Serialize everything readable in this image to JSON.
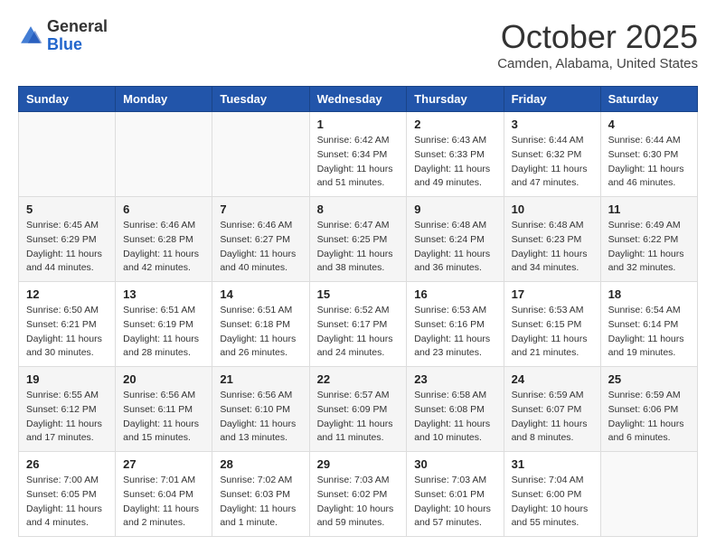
{
  "header": {
    "logo_general": "General",
    "logo_blue": "Blue",
    "month_title": "October 2025",
    "location": "Camden, Alabama, United States"
  },
  "days_of_week": [
    "Sunday",
    "Monday",
    "Tuesday",
    "Wednesday",
    "Thursday",
    "Friday",
    "Saturday"
  ],
  "weeks": [
    [
      {
        "day": "",
        "sunrise": "",
        "sunset": "",
        "daylight": ""
      },
      {
        "day": "",
        "sunrise": "",
        "sunset": "",
        "daylight": ""
      },
      {
        "day": "",
        "sunrise": "",
        "sunset": "",
        "daylight": ""
      },
      {
        "day": "1",
        "sunrise": "Sunrise: 6:42 AM",
        "sunset": "Sunset: 6:34 PM",
        "daylight": "Daylight: 11 hours and 51 minutes."
      },
      {
        "day": "2",
        "sunrise": "Sunrise: 6:43 AM",
        "sunset": "Sunset: 6:33 PM",
        "daylight": "Daylight: 11 hours and 49 minutes."
      },
      {
        "day": "3",
        "sunrise": "Sunrise: 6:44 AM",
        "sunset": "Sunset: 6:32 PM",
        "daylight": "Daylight: 11 hours and 47 minutes."
      },
      {
        "day": "4",
        "sunrise": "Sunrise: 6:44 AM",
        "sunset": "Sunset: 6:30 PM",
        "daylight": "Daylight: 11 hours and 46 minutes."
      }
    ],
    [
      {
        "day": "5",
        "sunrise": "Sunrise: 6:45 AM",
        "sunset": "Sunset: 6:29 PM",
        "daylight": "Daylight: 11 hours and 44 minutes."
      },
      {
        "day": "6",
        "sunrise": "Sunrise: 6:46 AM",
        "sunset": "Sunset: 6:28 PM",
        "daylight": "Daylight: 11 hours and 42 minutes."
      },
      {
        "day": "7",
        "sunrise": "Sunrise: 6:46 AM",
        "sunset": "Sunset: 6:27 PM",
        "daylight": "Daylight: 11 hours and 40 minutes."
      },
      {
        "day": "8",
        "sunrise": "Sunrise: 6:47 AM",
        "sunset": "Sunset: 6:25 PM",
        "daylight": "Daylight: 11 hours and 38 minutes."
      },
      {
        "day": "9",
        "sunrise": "Sunrise: 6:48 AM",
        "sunset": "Sunset: 6:24 PM",
        "daylight": "Daylight: 11 hours and 36 minutes."
      },
      {
        "day": "10",
        "sunrise": "Sunrise: 6:48 AM",
        "sunset": "Sunset: 6:23 PM",
        "daylight": "Daylight: 11 hours and 34 minutes."
      },
      {
        "day": "11",
        "sunrise": "Sunrise: 6:49 AM",
        "sunset": "Sunset: 6:22 PM",
        "daylight": "Daylight: 11 hours and 32 minutes."
      }
    ],
    [
      {
        "day": "12",
        "sunrise": "Sunrise: 6:50 AM",
        "sunset": "Sunset: 6:21 PM",
        "daylight": "Daylight: 11 hours and 30 minutes."
      },
      {
        "day": "13",
        "sunrise": "Sunrise: 6:51 AM",
        "sunset": "Sunset: 6:19 PM",
        "daylight": "Daylight: 11 hours and 28 minutes."
      },
      {
        "day": "14",
        "sunrise": "Sunrise: 6:51 AM",
        "sunset": "Sunset: 6:18 PM",
        "daylight": "Daylight: 11 hours and 26 minutes."
      },
      {
        "day": "15",
        "sunrise": "Sunrise: 6:52 AM",
        "sunset": "Sunset: 6:17 PM",
        "daylight": "Daylight: 11 hours and 24 minutes."
      },
      {
        "day": "16",
        "sunrise": "Sunrise: 6:53 AM",
        "sunset": "Sunset: 6:16 PM",
        "daylight": "Daylight: 11 hours and 23 minutes."
      },
      {
        "day": "17",
        "sunrise": "Sunrise: 6:53 AM",
        "sunset": "Sunset: 6:15 PM",
        "daylight": "Daylight: 11 hours and 21 minutes."
      },
      {
        "day": "18",
        "sunrise": "Sunrise: 6:54 AM",
        "sunset": "Sunset: 6:14 PM",
        "daylight": "Daylight: 11 hours and 19 minutes."
      }
    ],
    [
      {
        "day": "19",
        "sunrise": "Sunrise: 6:55 AM",
        "sunset": "Sunset: 6:12 PM",
        "daylight": "Daylight: 11 hours and 17 minutes."
      },
      {
        "day": "20",
        "sunrise": "Sunrise: 6:56 AM",
        "sunset": "Sunset: 6:11 PM",
        "daylight": "Daylight: 11 hours and 15 minutes."
      },
      {
        "day": "21",
        "sunrise": "Sunrise: 6:56 AM",
        "sunset": "Sunset: 6:10 PM",
        "daylight": "Daylight: 11 hours and 13 minutes."
      },
      {
        "day": "22",
        "sunrise": "Sunrise: 6:57 AM",
        "sunset": "Sunset: 6:09 PM",
        "daylight": "Daylight: 11 hours and 11 minutes."
      },
      {
        "day": "23",
        "sunrise": "Sunrise: 6:58 AM",
        "sunset": "Sunset: 6:08 PM",
        "daylight": "Daylight: 11 hours and 10 minutes."
      },
      {
        "day": "24",
        "sunrise": "Sunrise: 6:59 AM",
        "sunset": "Sunset: 6:07 PM",
        "daylight": "Daylight: 11 hours and 8 minutes."
      },
      {
        "day": "25",
        "sunrise": "Sunrise: 6:59 AM",
        "sunset": "Sunset: 6:06 PM",
        "daylight": "Daylight: 11 hours and 6 minutes."
      }
    ],
    [
      {
        "day": "26",
        "sunrise": "Sunrise: 7:00 AM",
        "sunset": "Sunset: 6:05 PM",
        "daylight": "Daylight: 11 hours and 4 minutes."
      },
      {
        "day": "27",
        "sunrise": "Sunrise: 7:01 AM",
        "sunset": "Sunset: 6:04 PM",
        "daylight": "Daylight: 11 hours and 2 minutes."
      },
      {
        "day": "28",
        "sunrise": "Sunrise: 7:02 AM",
        "sunset": "Sunset: 6:03 PM",
        "daylight": "Daylight: 11 hours and 1 minute."
      },
      {
        "day": "29",
        "sunrise": "Sunrise: 7:03 AM",
        "sunset": "Sunset: 6:02 PM",
        "daylight": "Daylight: 10 hours and 59 minutes."
      },
      {
        "day": "30",
        "sunrise": "Sunrise: 7:03 AM",
        "sunset": "Sunset: 6:01 PM",
        "daylight": "Daylight: 10 hours and 57 minutes."
      },
      {
        "day": "31",
        "sunrise": "Sunrise: 7:04 AM",
        "sunset": "Sunset: 6:00 PM",
        "daylight": "Daylight: 10 hours and 55 minutes."
      },
      {
        "day": "",
        "sunrise": "",
        "sunset": "",
        "daylight": ""
      }
    ]
  ]
}
